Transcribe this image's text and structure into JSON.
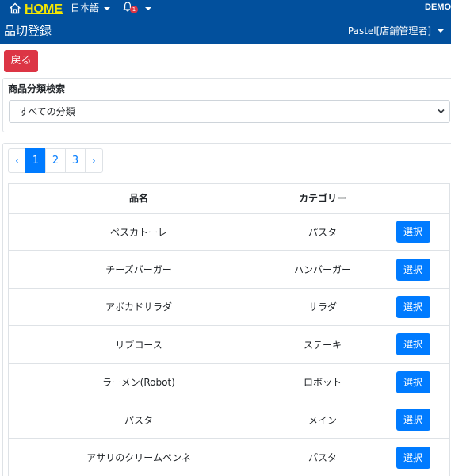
{
  "header": {
    "home_label": "HOME",
    "language": "日本語",
    "notification_count": "1",
    "demo_label": "DEMO",
    "page_title": "品切登録",
    "user_menu": "Pastel[店舗管理者]"
  },
  "actions": {
    "back_label": "戻る"
  },
  "filter": {
    "label": "商品分類検索",
    "selected": "すべての分類"
  },
  "pagination": {
    "prev": "‹",
    "pages": [
      "1",
      "2",
      "3"
    ],
    "current": "1",
    "next": "›"
  },
  "table": {
    "columns": [
      "品名",
      "カテゴリー",
      ""
    ],
    "rows": [
      {
        "name": "ペスカトーレ",
        "category": "パスタ",
        "action": "選択"
      },
      {
        "name": "チーズバーガー",
        "category": "ハンバーガー",
        "action": "選択"
      },
      {
        "name": "アボカドサラダ",
        "category": "サラダ",
        "action": "選択"
      },
      {
        "name": "リブロース",
        "category": "ステーキ",
        "action": "選択"
      },
      {
        "name": "ラーメン(Robot)",
        "category": "ロボット",
        "action": "選択"
      },
      {
        "name": "パスタ",
        "category": "メイン",
        "action": "選択"
      },
      {
        "name": "アサリのクリームペンネ",
        "category": "パスタ",
        "action": "選択"
      }
    ]
  },
  "colors": {
    "header_bg": "#02509d",
    "home_text": "#f5e600",
    "back_button": "#dc3545",
    "primary": "#007bff",
    "badge": "#dc3545"
  },
  "icons": {
    "home": "home-icon",
    "bell": "bell-icon",
    "select": "chevron-down-icon"
  }
}
